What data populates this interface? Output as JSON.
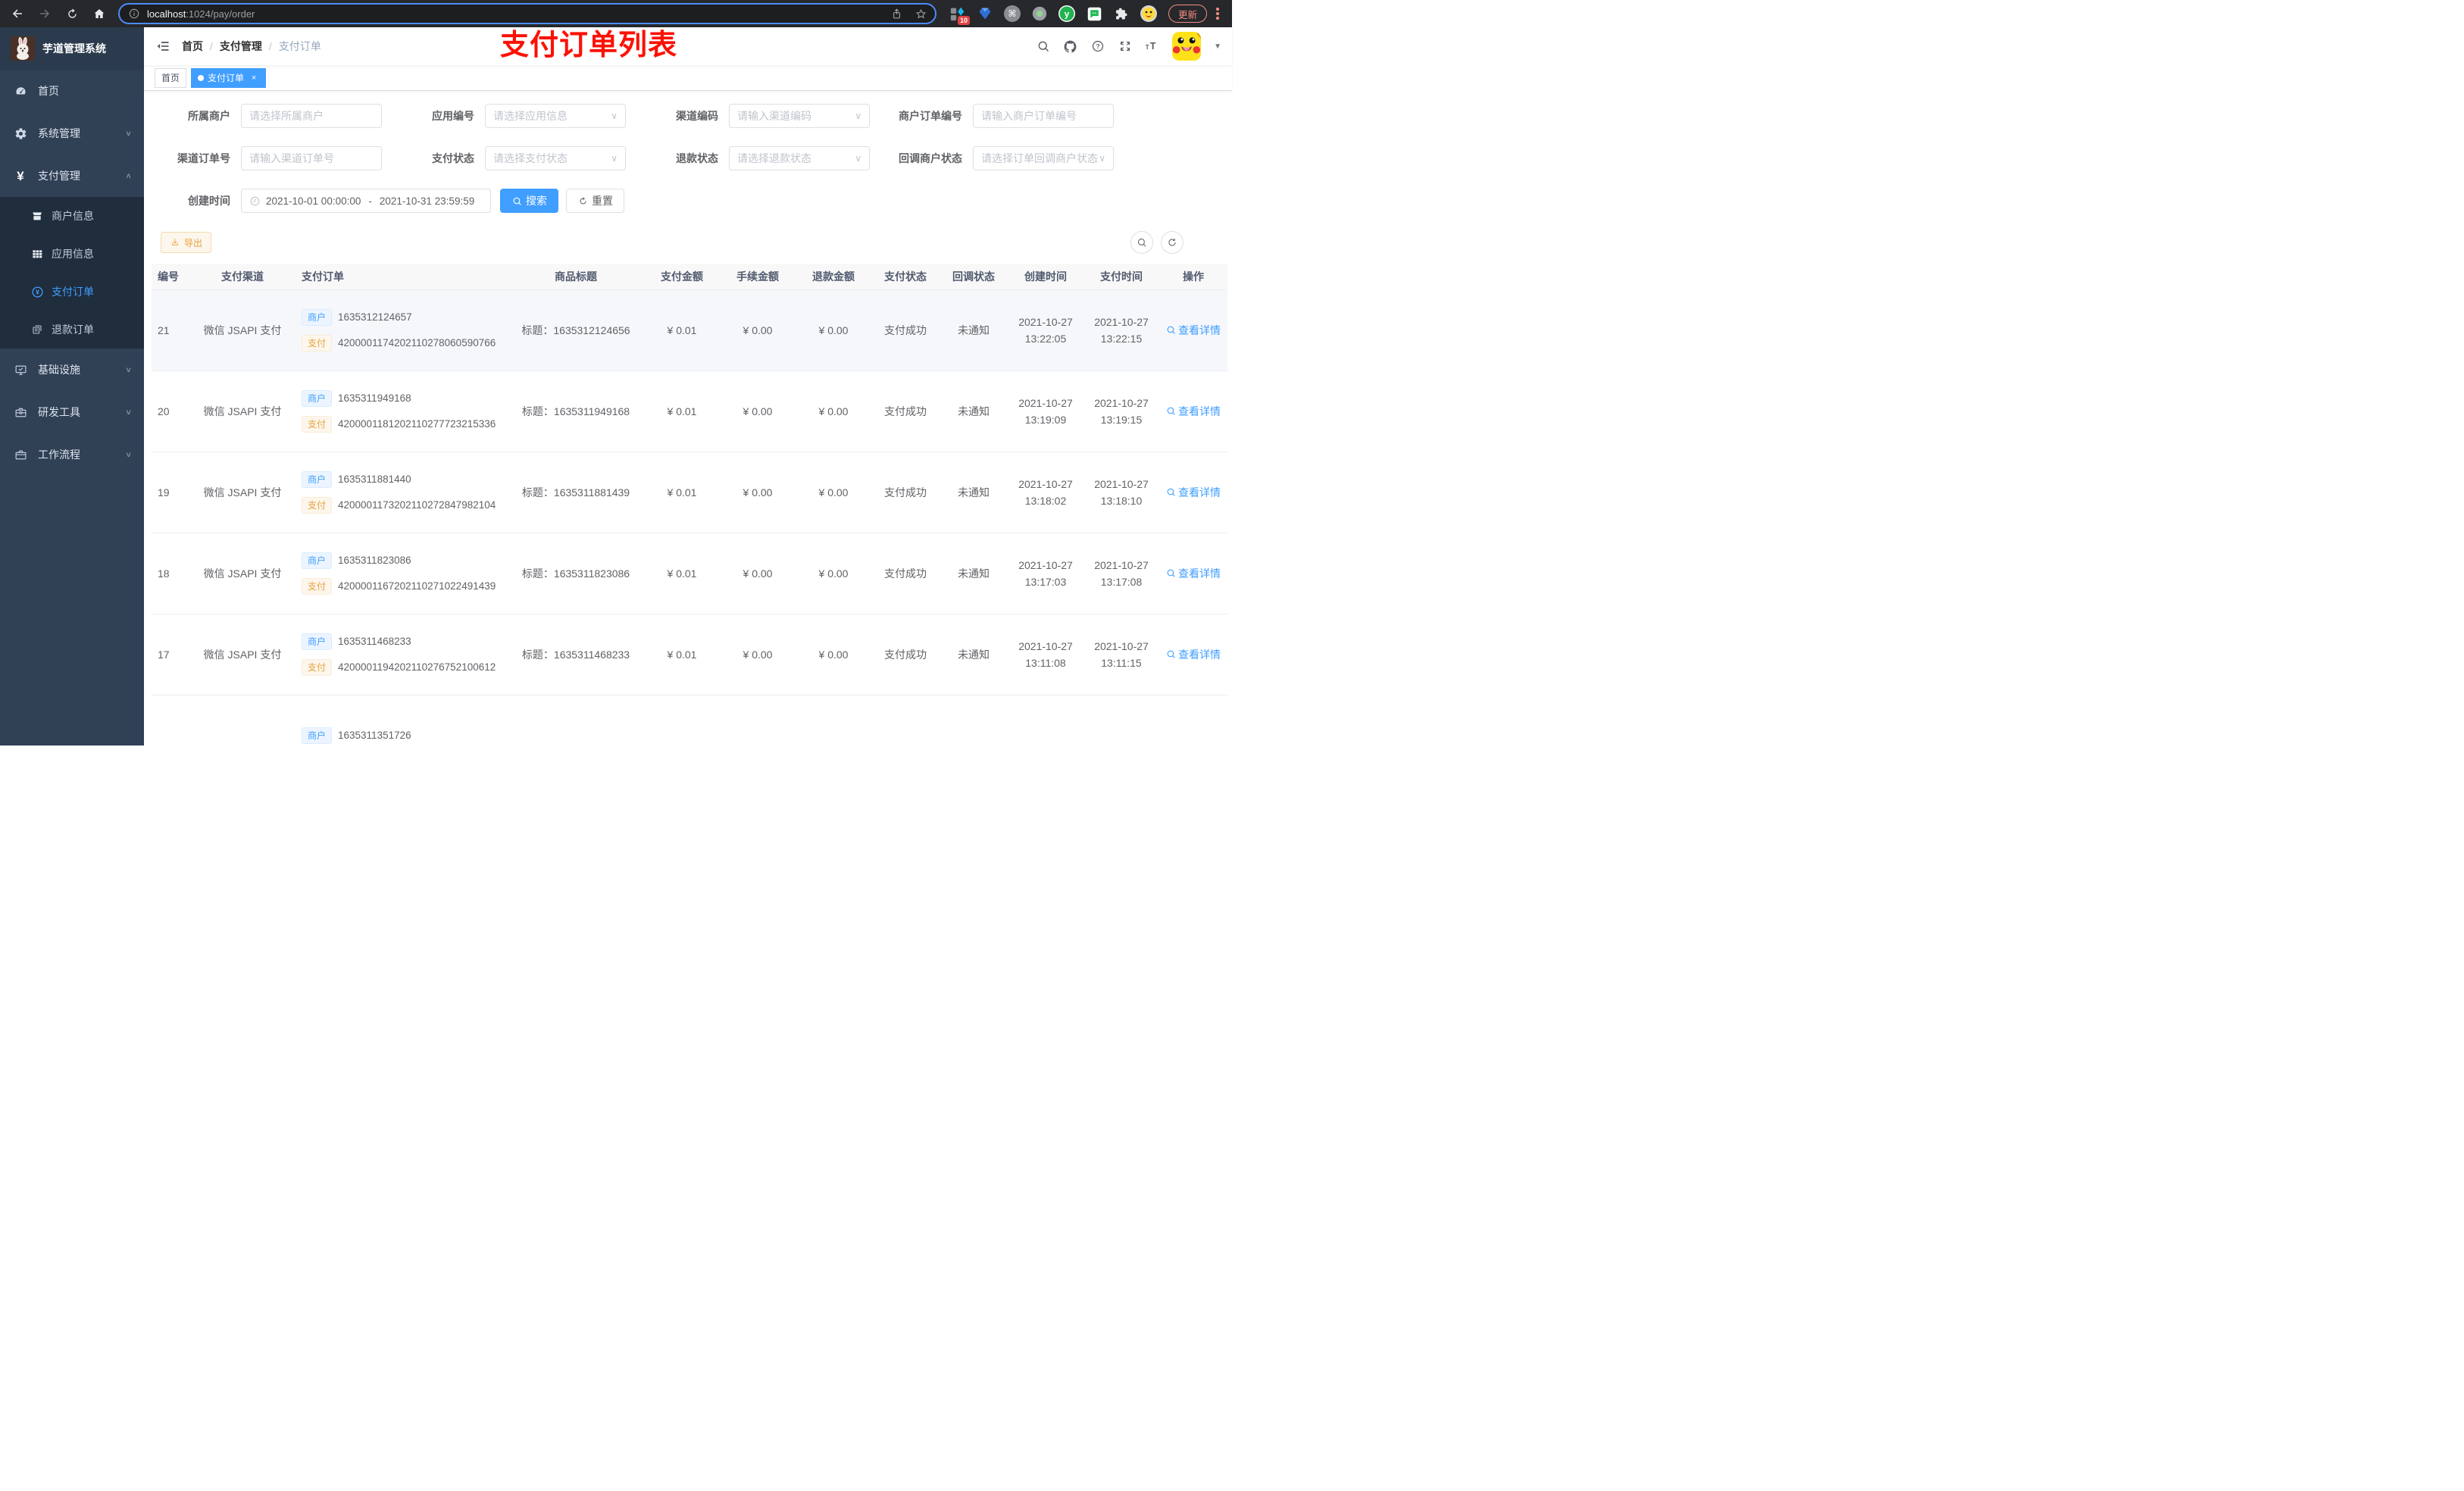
{
  "browser": {
    "url": {
      "host": "localhost",
      "path": ":1024/pay/order"
    },
    "extension_badge": "10",
    "update_button": "更新"
  },
  "sidebar": {
    "logo_title": "芋道管理系统",
    "menu": [
      {
        "label": "首页"
      },
      {
        "label": "系统管理"
      },
      {
        "label": "支付管理"
      },
      {
        "label": "基础设施"
      },
      {
        "label": "研发工具"
      },
      {
        "label": "工作流程"
      }
    ],
    "submenu_payment": [
      {
        "label": "商户信息",
        "active": false
      },
      {
        "label": "应用信息",
        "active": false
      },
      {
        "label": "支付订单",
        "active": true
      },
      {
        "label": "退款订单",
        "active": false
      }
    ]
  },
  "navbar": {
    "breadcrumb": [
      "首页",
      "支付管理",
      "支付订单"
    ],
    "annotation": "支付订单列表"
  },
  "tabs": [
    {
      "label": "首页",
      "active": false,
      "closable": false
    },
    {
      "label": "支付订单",
      "active": true,
      "closable": true
    }
  ],
  "filters": {
    "fields": [
      {
        "row": 1,
        "label": "所属商户",
        "placeholder": "请选择所属商户",
        "type": "input"
      },
      {
        "row": 1,
        "label": "应用编号",
        "placeholder": "请选择应用信息",
        "type": "select"
      },
      {
        "row": 1,
        "label": "渠道编码",
        "placeholder": "请输入渠道编码",
        "type": "select"
      },
      {
        "row": 1,
        "label": "商户订单编号",
        "placeholder": "请输入商户订单编号",
        "type": "input"
      },
      {
        "row": 2,
        "label": "渠道订单号",
        "placeholder": "请输入渠道订单号",
        "type": "input"
      },
      {
        "row": 2,
        "label": "支付状态",
        "placeholder": "请选择支付状态",
        "type": "select"
      },
      {
        "row": 2,
        "label": "退款状态",
        "placeholder": "请选择退款状态",
        "type": "select"
      },
      {
        "row": 2,
        "label": "回调商户状态",
        "placeholder": "请选择订单回调商户状态",
        "type": "select"
      }
    ],
    "date": {
      "label": "创建时间",
      "start": "2021-10-01 00:00:00",
      "separator": "-",
      "end": "2021-10-31 23:59:59"
    },
    "search_label": "搜索",
    "reset_label": "重置"
  },
  "toolbar": {
    "export_label": "导出"
  },
  "table": {
    "columns": [
      "编号",
      "支付渠道",
      "支付订单",
      "商品标题",
      "支付金额",
      "手续金额",
      "退款金额",
      "支付状态",
      "回调状态",
      "创建时间",
      "支付时间",
      "操作"
    ],
    "rows": [
      {
        "id": "21",
        "channel": "微信 JSAPI 支付",
        "merchant_tag": "商户",
        "merchant_no": "1635312124657",
        "pay_tag": "支付",
        "pay_no": "4200001174202110278060590766",
        "title": "标题：1635312124656",
        "amount": "¥ 0.01",
        "fee": "¥ 0.00",
        "refund": "¥ 0.00",
        "status": "支付成功",
        "notify": "未通知",
        "create_date": "2021-10-27",
        "create_time": "13:22:05",
        "pay_date": "2021-10-27",
        "pay_time": "13:22:15",
        "action": "查看详情"
      },
      {
        "id": "20",
        "channel": "微信 JSAPI 支付",
        "merchant_tag": "商户",
        "merchant_no": "1635311949168",
        "pay_tag": "支付",
        "pay_no": "4200001181202110277723215336",
        "title": "标题：1635311949168",
        "amount": "¥ 0.01",
        "fee": "¥ 0.00",
        "refund": "¥ 0.00",
        "status": "支付成功",
        "notify": "未通知",
        "create_date": "2021-10-27",
        "create_time": "13:19:09",
        "pay_date": "2021-10-27",
        "pay_time": "13:19:15",
        "action": "查看详情"
      },
      {
        "id": "19",
        "channel": "微信 JSAPI 支付",
        "merchant_tag": "商户",
        "merchant_no": "1635311881440",
        "pay_tag": "支付",
        "pay_no": "4200001173202110272847982104",
        "title": "标题：1635311881439",
        "amount": "¥ 0.01",
        "fee": "¥ 0.00",
        "refund": "¥ 0.00",
        "status": "支付成功",
        "notify": "未通知",
        "create_date": "2021-10-27",
        "create_time": "13:18:02",
        "pay_date": "2021-10-27",
        "pay_time": "13:18:10",
        "action": "查看详情"
      },
      {
        "id": "18",
        "channel": "微信 JSAPI 支付",
        "merchant_tag": "商户",
        "merchant_no": "1635311823086",
        "pay_tag": "支付",
        "pay_no": "4200001167202110271022491439",
        "title": "标题：1635311823086",
        "amount": "¥ 0.01",
        "fee": "¥ 0.00",
        "refund": "¥ 0.00",
        "status": "支付成功",
        "notify": "未通知",
        "create_date": "2021-10-27",
        "create_time": "13:17:03",
        "pay_date": "2021-10-27",
        "pay_time": "13:17:08",
        "action": "查看详情"
      },
      {
        "id": "17",
        "channel": "微信 JSAPI 支付",
        "merchant_tag": "商户",
        "merchant_no": "1635311468233",
        "pay_tag": "支付",
        "pay_no": "4200001194202110276752100612",
        "title": "标题：1635311468233",
        "amount": "¥ 0.01",
        "fee": "¥ 0.00",
        "refund": "¥ 0.00",
        "status": "支付成功",
        "notify": "未通知",
        "create_date": "2021-10-27",
        "create_time": "13:11:08",
        "pay_date": "2021-10-27",
        "pay_time": "13:11:15",
        "action": "查看详情"
      },
      {
        "id": "",
        "channel": "",
        "merchant_tag": "商户",
        "merchant_no": "1635311351726",
        "pay_tag": "",
        "pay_no": "",
        "title": "",
        "amount": "",
        "fee": "",
        "refund": "",
        "status": "",
        "notify": "",
        "create_date": "",
        "create_time": "",
        "pay_date": "",
        "pay_time": "",
        "action": ""
      }
    ]
  }
}
